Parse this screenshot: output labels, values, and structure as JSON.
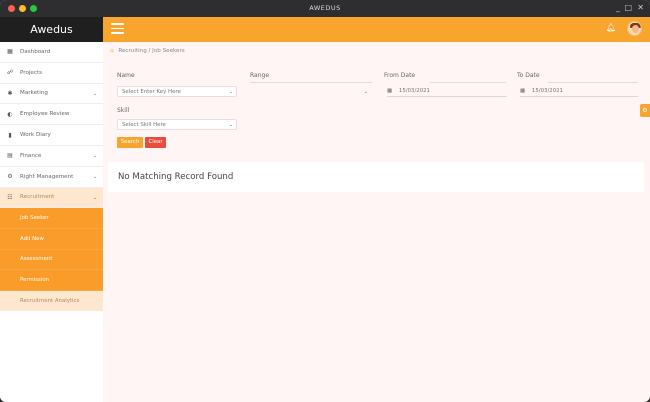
{
  "window": {
    "title": "AWEDUS",
    "minimize": "_",
    "maximize": "□",
    "close": "✕"
  },
  "brand": "Awedus",
  "sidebar": {
    "items": [
      {
        "label": "Dashboard",
        "icon": "▦"
      },
      {
        "label": "Projects",
        "icon": "☍"
      },
      {
        "label": "Marketing",
        "icon": "✱",
        "chevron": "⌄"
      },
      {
        "label": "Employee Review",
        "icon": "◐"
      },
      {
        "label": "Work Diary",
        "icon": "▮"
      },
      {
        "label": "Finance",
        "icon": "▤",
        "chevron": "⌄"
      },
      {
        "label": "Right Management",
        "icon": "⚙",
        "chevron": "⌄"
      },
      {
        "label": "Recruitment",
        "icon": "☷",
        "chevron": "⌄"
      }
    ],
    "submenu": [
      "Job Seeker",
      "Add New",
      "Assessment",
      "Permission",
      "Recruitment Analytics"
    ]
  },
  "breadcrumb": {
    "home_icon": "⌂",
    "text": "Recruiting / Job Seekers"
  },
  "filters": {
    "name_label": "Name",
    "name_value": "Select Enter Key Here",
    "range_label": "Range",
    "range_value": "",
    "from_label": "From Date",
    "from_value": "15/03/2021",
    "to_label": "To Date",
    "to_value": "15/03/2021",
    "skill_label": "Skill",
    "skill_value": "Select Skill Here",
    "caret": "⌄",
    "cal_icon": "▦"
  },
  "buttons": {
    "search": "Search",
    "clear": "Clear"
  },
  "result": {
    "message": "No Matching Record Found"
  },
  "side_tab_icon": "⚙",
  "colors": {
    "accent": "#f7a52d",
    "danger": "#e74c3c",
    "dark": "#1f1f1f"
  }
}
